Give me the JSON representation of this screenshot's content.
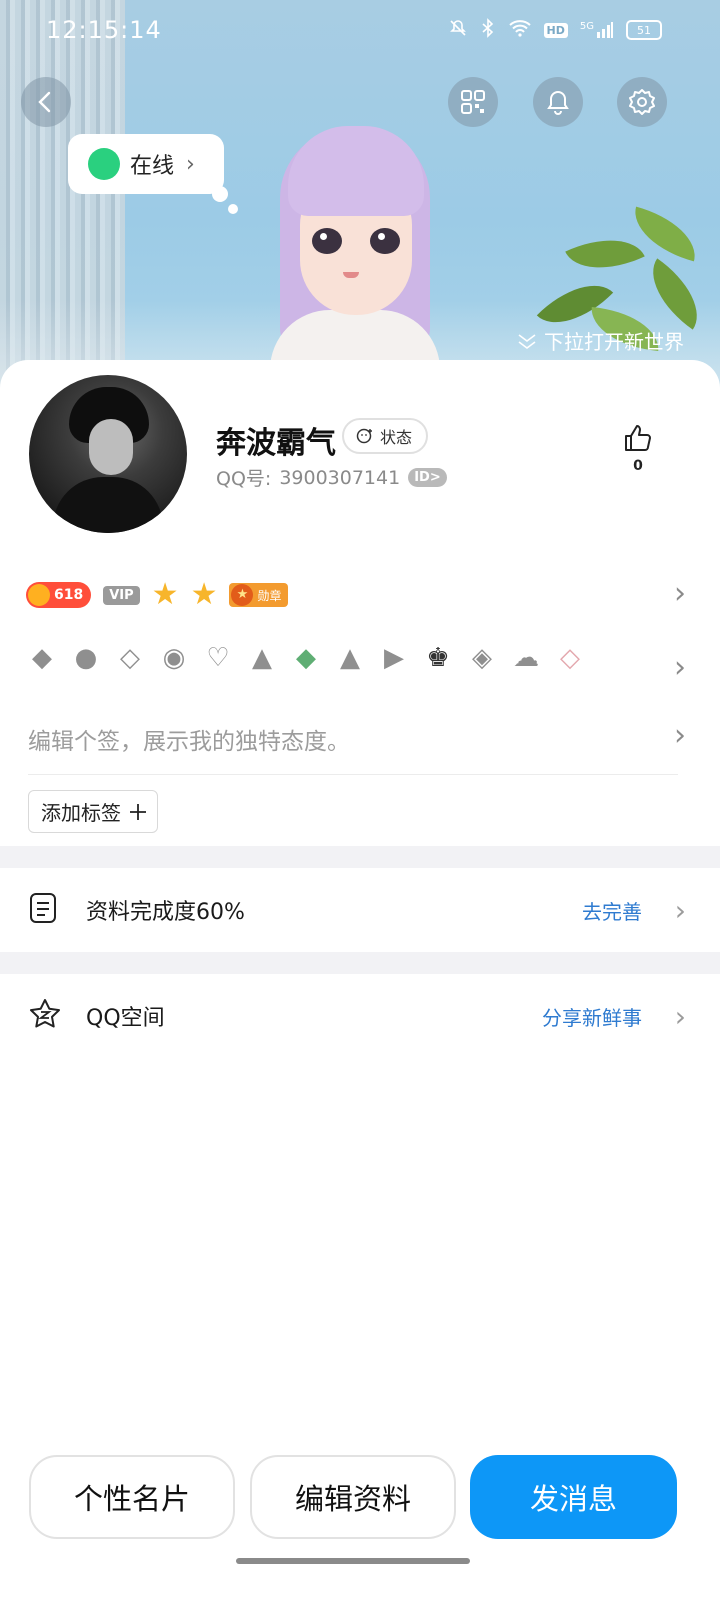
{
  "status_bar": {
    "time": "12:15:14",
    "battery": "51",
    "network": "5G",
    "hd_label": "HD"
  },
  "hero": {
    "online_status": "在线",
    "pull_hint": "下拉打开新世界",
    "back_icon": "chevron-left-icon",
    "qr_icon": "qr-code-icon",
    "bell_icon": "bell-icon",
    "settings_icon": "gear-icon"
  },
  "profile": {
    "name": "奔波霸气",
    "status_label": "状态",
    "qq_prefix": "QQ号:",
    "qq_number": "3900307141",
    "id_badge": "ID>",
    "likes": "0"
  },
  "badges": {
    "coin_value": "618",
    "vip": "VIP",
    "stars": 2,
    "medal_label": "勋章"
  },
  "signature_placeholder": "编辑个签，展示我的独特态度。",
  "add_tag_label": "添加标签",
  "rows": [
    {
      "label": "资料完成度60%",
      "action": "去完善",
      "icon": "document-icon"
    },
    {
      "label": "QQ空间",
      "action": "分享新鲜事",
      "icon": "star-z-icon"
    }
  ],
  "bottom_buttons": {
    "card": "个性名片",
    "edit": "编辑资料",
    "message": "发消息"
  },
  "colors": {
    "primary": "#0d97f7",
    "online": "#2ad07f",
    "link": "#2f7bd0",
    "coin": "#ff4e3a"
  }
}
